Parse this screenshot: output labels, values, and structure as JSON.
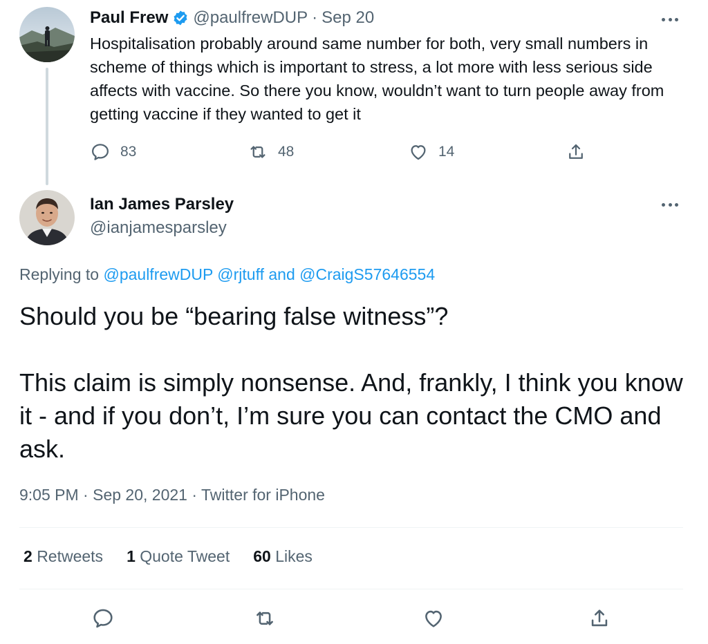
{
  "parent_tweet": {
    "display_name": "Paul Frew",
    "handle": "@paulfrewDUP",
    "separator": "·",
    "date": "Sep 20",
    "text": "Hospitalisation probably around same number for both, very small numbers in scheme of things which is important to stress, a lot more with less serious side affects with vaccine. So there you know, wouldn’t want to turn people away from getting vaccine if they wanted to get it",
    "reply_count": "83",
    "retweet_count": "48",
    "like_count": "14"
  },
  "main_tweet": {
    "display_name": "Ian James Parsley",
    "handle": "@ianjamesparsley",
    "replying_prefix": "Replying to",
    "mention_1": "@paulfrewDUP",
    "mention_2": "@rjtuff",
    "and_text": "and",
    "mention_3": "@CraigS57646554",
    "text_para_1": "Should you be “bearing false witness”?",
    "text_para_2": "This claim is simply nonsense. And, frankly, I think you know it - and if you don’t, I’m sure you can contact the CMO and ask.",
    "time": "9:05 PM",
    "date": "Sep 20, 2021",
    "source": "Twitter for iPhone",
    "separator": "·",
    "retweets_count": "2",
    "retweets_label": "Retweets",
    "quote_count": "1",
    "quote_label": "Quote Tweet",
    "likes_count": "60",
    "likes_label": "Likes"
  },
  "colors": {
    "text": "#0f1419",
    "secondary": "#536471",
    "link": "#1d9bf0",
    "verified": "#1d9bf0",
    "divider": "#eff3f4",
    "thread_line": "#cfd9de"
  },
  "icons": {
    "verified": "verified-badge-icon",
    "more": "more-dots-icon",
    "reply": "reply-bubble-icon",
    "retweet": "retweet-icon",
    "like": "heart-icon",
    "share": "share-upload-icon"
  }
}
